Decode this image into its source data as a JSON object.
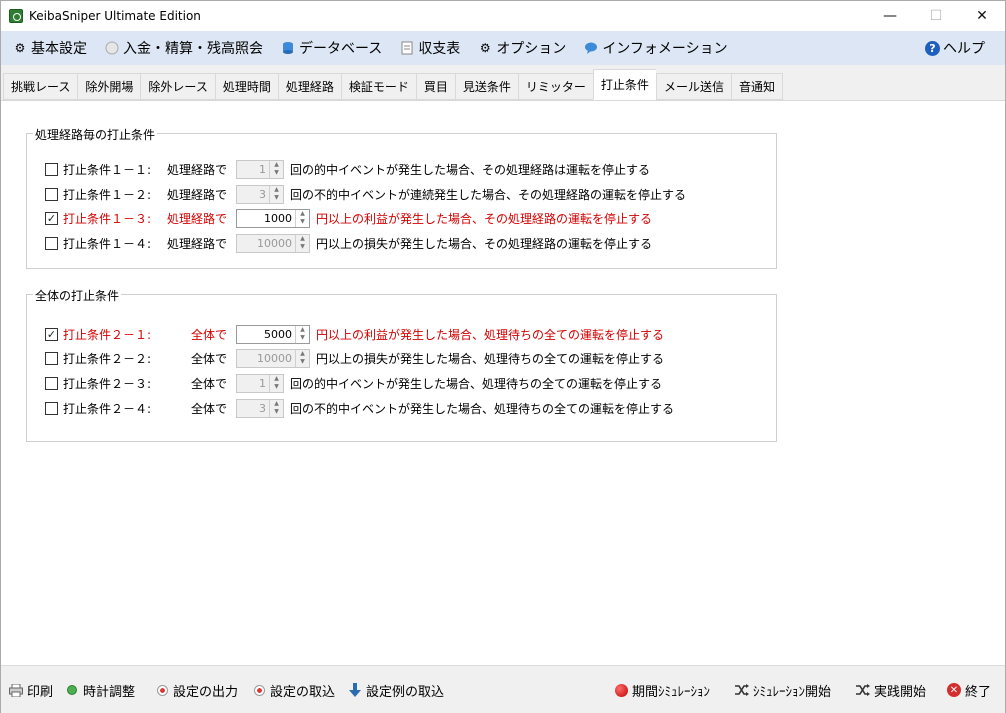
{
  "window": {
    "title": "KeibaSniper Ultimate Edition",
    "controls": {
      "minimize": "—",
      "maximize": "☐",
      "close": "✕"
    }
  },
  "menu": {
    "items": [
      {
        "label": "基本設定",
        "icon": "gear-icon"
      },
      {
        "label": "入金・精算・残高照会",
        "icon": "coin-icon"
      },
      {
        "label": "データベース",
        "icon": "database-icon"
      },
      {
        "label": "収支表",
        "icon": "ledger-icon"
      },
      {
        "label": "オプション",
        "icon": "gear-icon"
      },
      {
        "label": "インフォメーション",
        "icon": "speech-bubble-icon"
      }
    ],
    "help": {
      "label": "ヘルプ",
      "glyph": "?"
    }
  },
  "tabs": {
    "items": [
      "挑戦レース",
      "除外開場",
      "除外レース",
      "処理時間",
      "処理経路",
      "検証モード",
      "買目",
      "見送条件",
      "リミッター",
      "打止条件",
      "メール送信",
      "音通知"
    ],
    "active_index": 9
  },
  "group1": {
    "title": "処理経路毎の打止条件",
    "rows": [
      {
        "checked": false,
        "label": "打止条件１－１:",
        "scope": "処理経路で",
        "value": "1",
        "enabled": false,
        "suffix": "回の的中イベントが発生した場合、その処理経路は運転を停止する"
      },
      {
        "checked": false,
        "label": "打止条件１－２:",
        "scope": "処理経路で",
        "value": "3",
        "enabled": false,
        "suffix": "回の不的中イベントが連続発生した場合、その処理経路の運転を停止する"
      },
      {
        "checked": true,
        "label": "打止条件１－３:",
        "scope": "処理経路で",
        "value": "1000",
        "enabled": true,
        "suffix": "円以上の利益が発生した場合、その処理経路の運転を停止する"
      },
      {
        "checked": false,
        "label": "打止条件１－４:",
        "scope": "処理経路で",
        "value": "10000",
        "enabled": false,
        "suffix": "円以上の損失が発生した場合、その処理経路の運転を停止する"
      }
    ]
  },
  "group2": {
    "title": "全体の打止条件",
    "rows": [
      {
        "checked": true,
        "label": "打止条件２－１:",
        "scope": "全体で",
        "value": "5000",
        "enabled": true,
        "suffix": "円以上の利益が発生した場合、処理待ちの全ての運転を停止する"
      },
      {
        "checked": false,
        "label": "打止条件２－２:",
        "scope": "全体で",
        "value": "10000",
        "enabled": false,
        "suffix": "円以上の損失が発生した場合、処理待ちの全ての運転を停止する"
      },
      {
        "checked": false,
        "label": "打止条件２－３:",
        "scope": "全体で",
        "value": "1",
        "enabled": false,
        "suffix": "回の的中イベントが発生した場合、処理待ちの全ての運転を停止する"
      },
      {
        "checked": false,
        "label": "打止条件２－４:",
        "scope": "全体で",
        "value": "3",
        "enabled": false,
        "suffix": "回の不的中イベントが発生した場合、処理待ちの全ての運転を停止する"
      }
    ]
  },
  "bottom": {
    "print": "印刷",
    "clock": "時計調整",
    "export": "設定の出力",
    "import": "設定の取込",
    "import_example": "設定例の取込",
    "period_sim": "期間ｼﾐｭﾚｰｼｮﾝ",
    "sim_start": "ｼﾐｭﾚｰｼｮﾝ開始",
    "live_start": "実践開始",
    "exit": "終了"
  },
  "colors": {
    "menubar_bg": "#dce6f4",
    "active_condition": "#d40000"
  }
}
